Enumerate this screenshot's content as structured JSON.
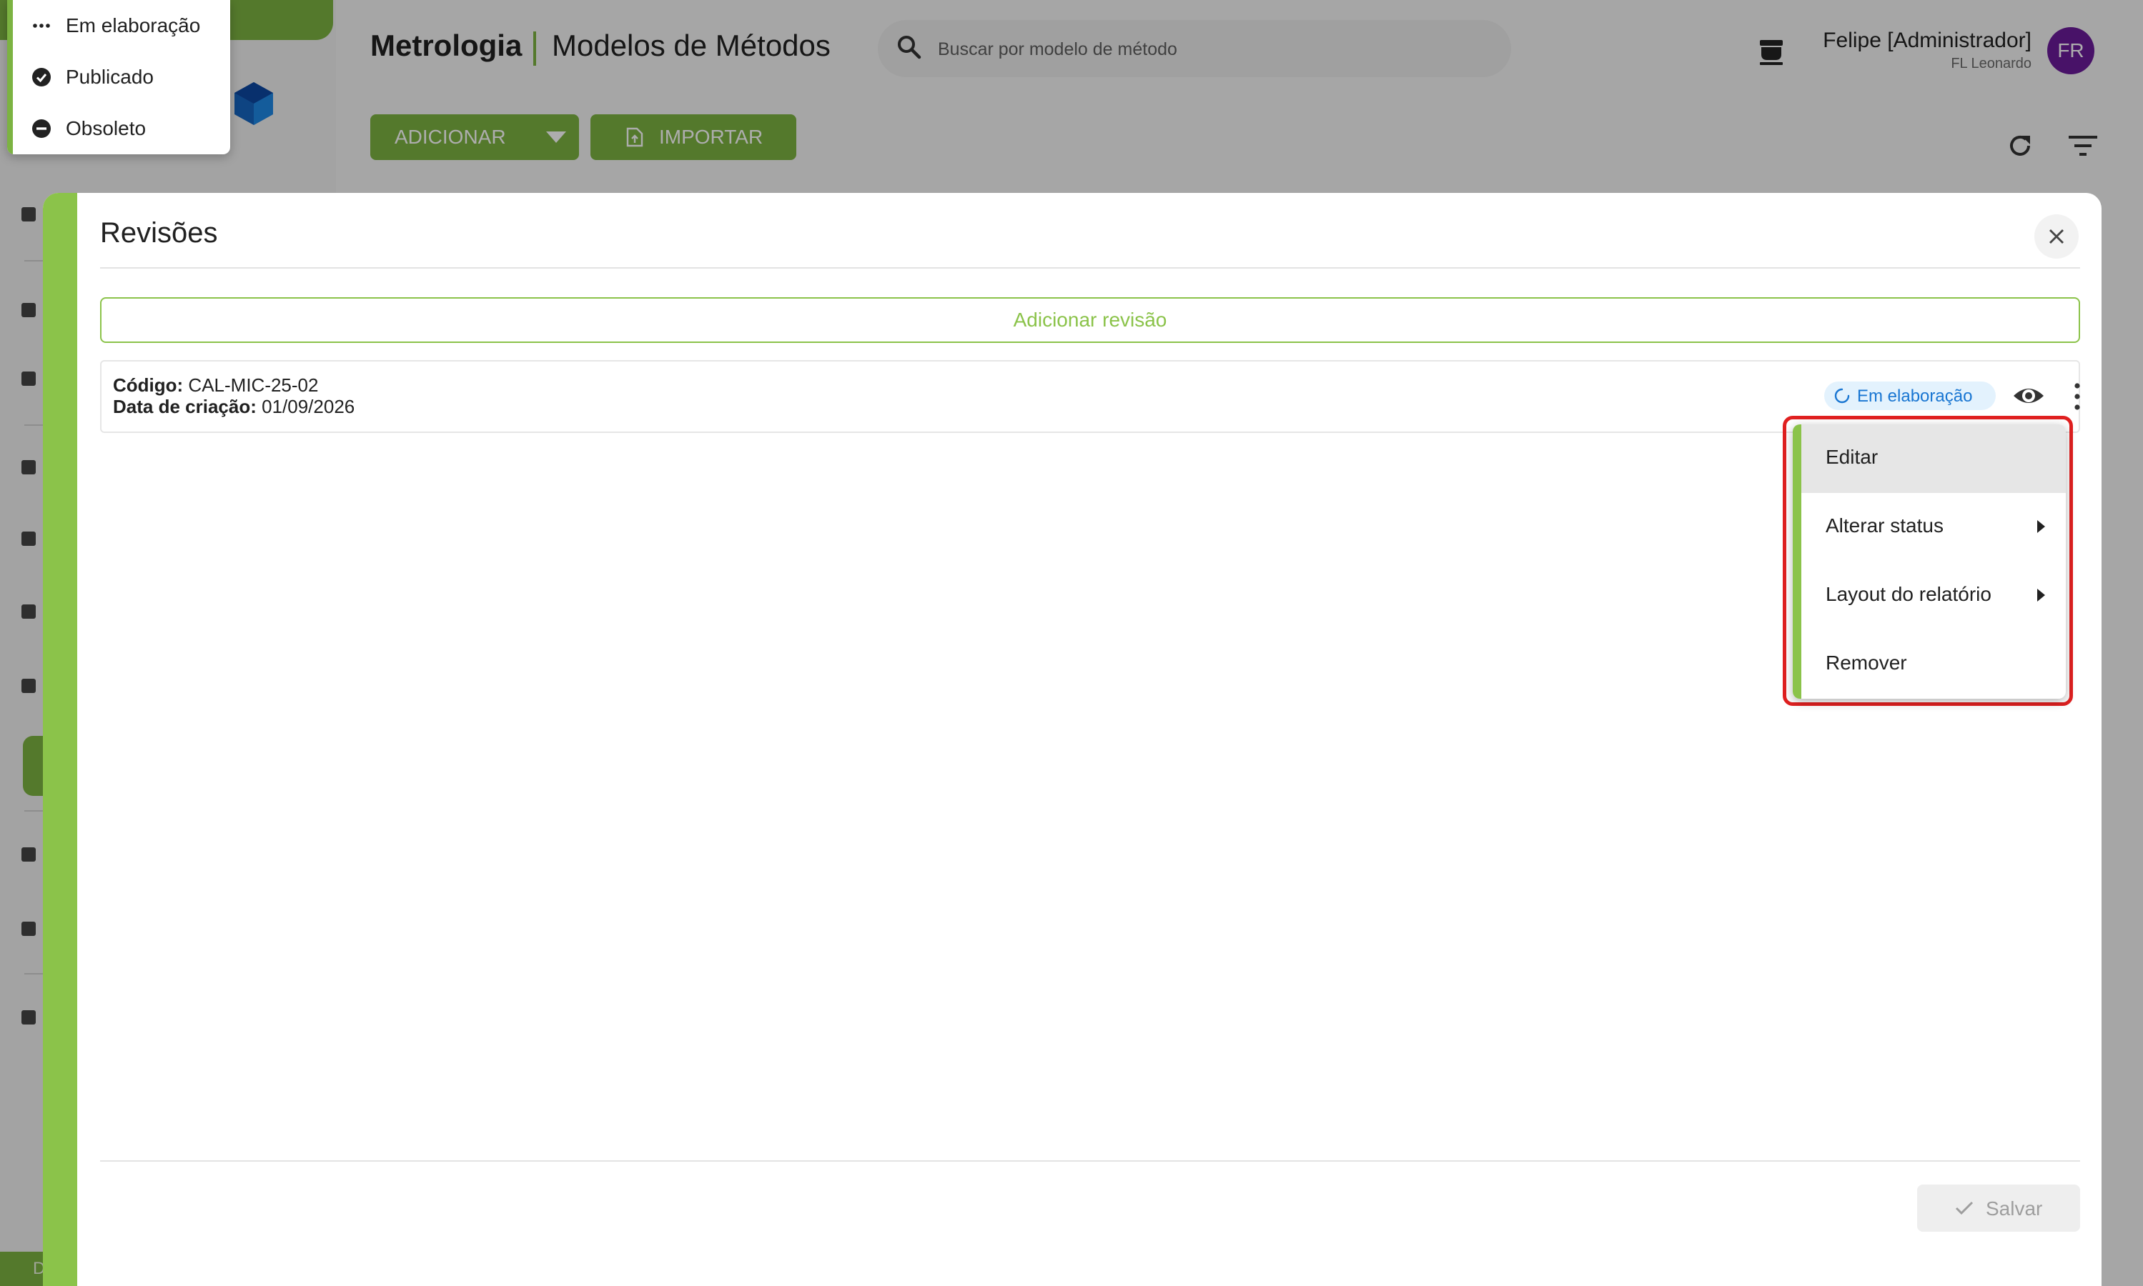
{
  "app": {
    "title": "Metrologia",
    "page_title": "Modelos de Métodos",
    "footer_label": "D"
  },
  "search": {
    "placeholder": "Buscar por modelo de método"
  },
  "user": {
    "name": "Felipe [Administrador]",
    "subtitle": "FL Leonardo",
    "initials": "FR"
  },
  "toolbar": {
    "add_label": "ADICIONAR",
    "import_label": "IMPORTAR"
  },
  "status_menu": {
    "items": [
      {
        "label": "Em elaboração",
        "icon": "more-horiz-icon"
      },
      {
        "label": "Publicado",
        "icon": "check-circle-icon"
      },
      {
        "label": "Obsoleto",
        "icon": "minus-circle-icon"
      }
    ]
  },
  "dialog": {
    "title": "Revisões",
    "add_revision_label": "Adicionar revisão",
    "save_label": "Salvar",
    "revision": {
      "code_label": "Código:",
      "code_value": "CAL-MIC-25-02",
      "date_label": "Data de criação:",
      "date_value": "01/09/2026",
      "status": "Em elaboração"
    }
  },
  "context_menu": {
    "items": [
      {
        "label": "Editar",
        "submenu": false
      },
      {
        "label": "Alterar status",
        "submenu": true
      },
      {
        "label": "Layout do relatório",
        "submenu": true
      },
      {
        "label": "Remover",
        "submenu": false
      }
    ]
  },
  "colors": {
    "accent": "#7cb342",
    "avatar": "#6a1b9a",
    "status_badge_bg": "#e3f2fd",
    "status_badge_text": "#1976d2",
    "highlight": "#e02020"
  }
}
